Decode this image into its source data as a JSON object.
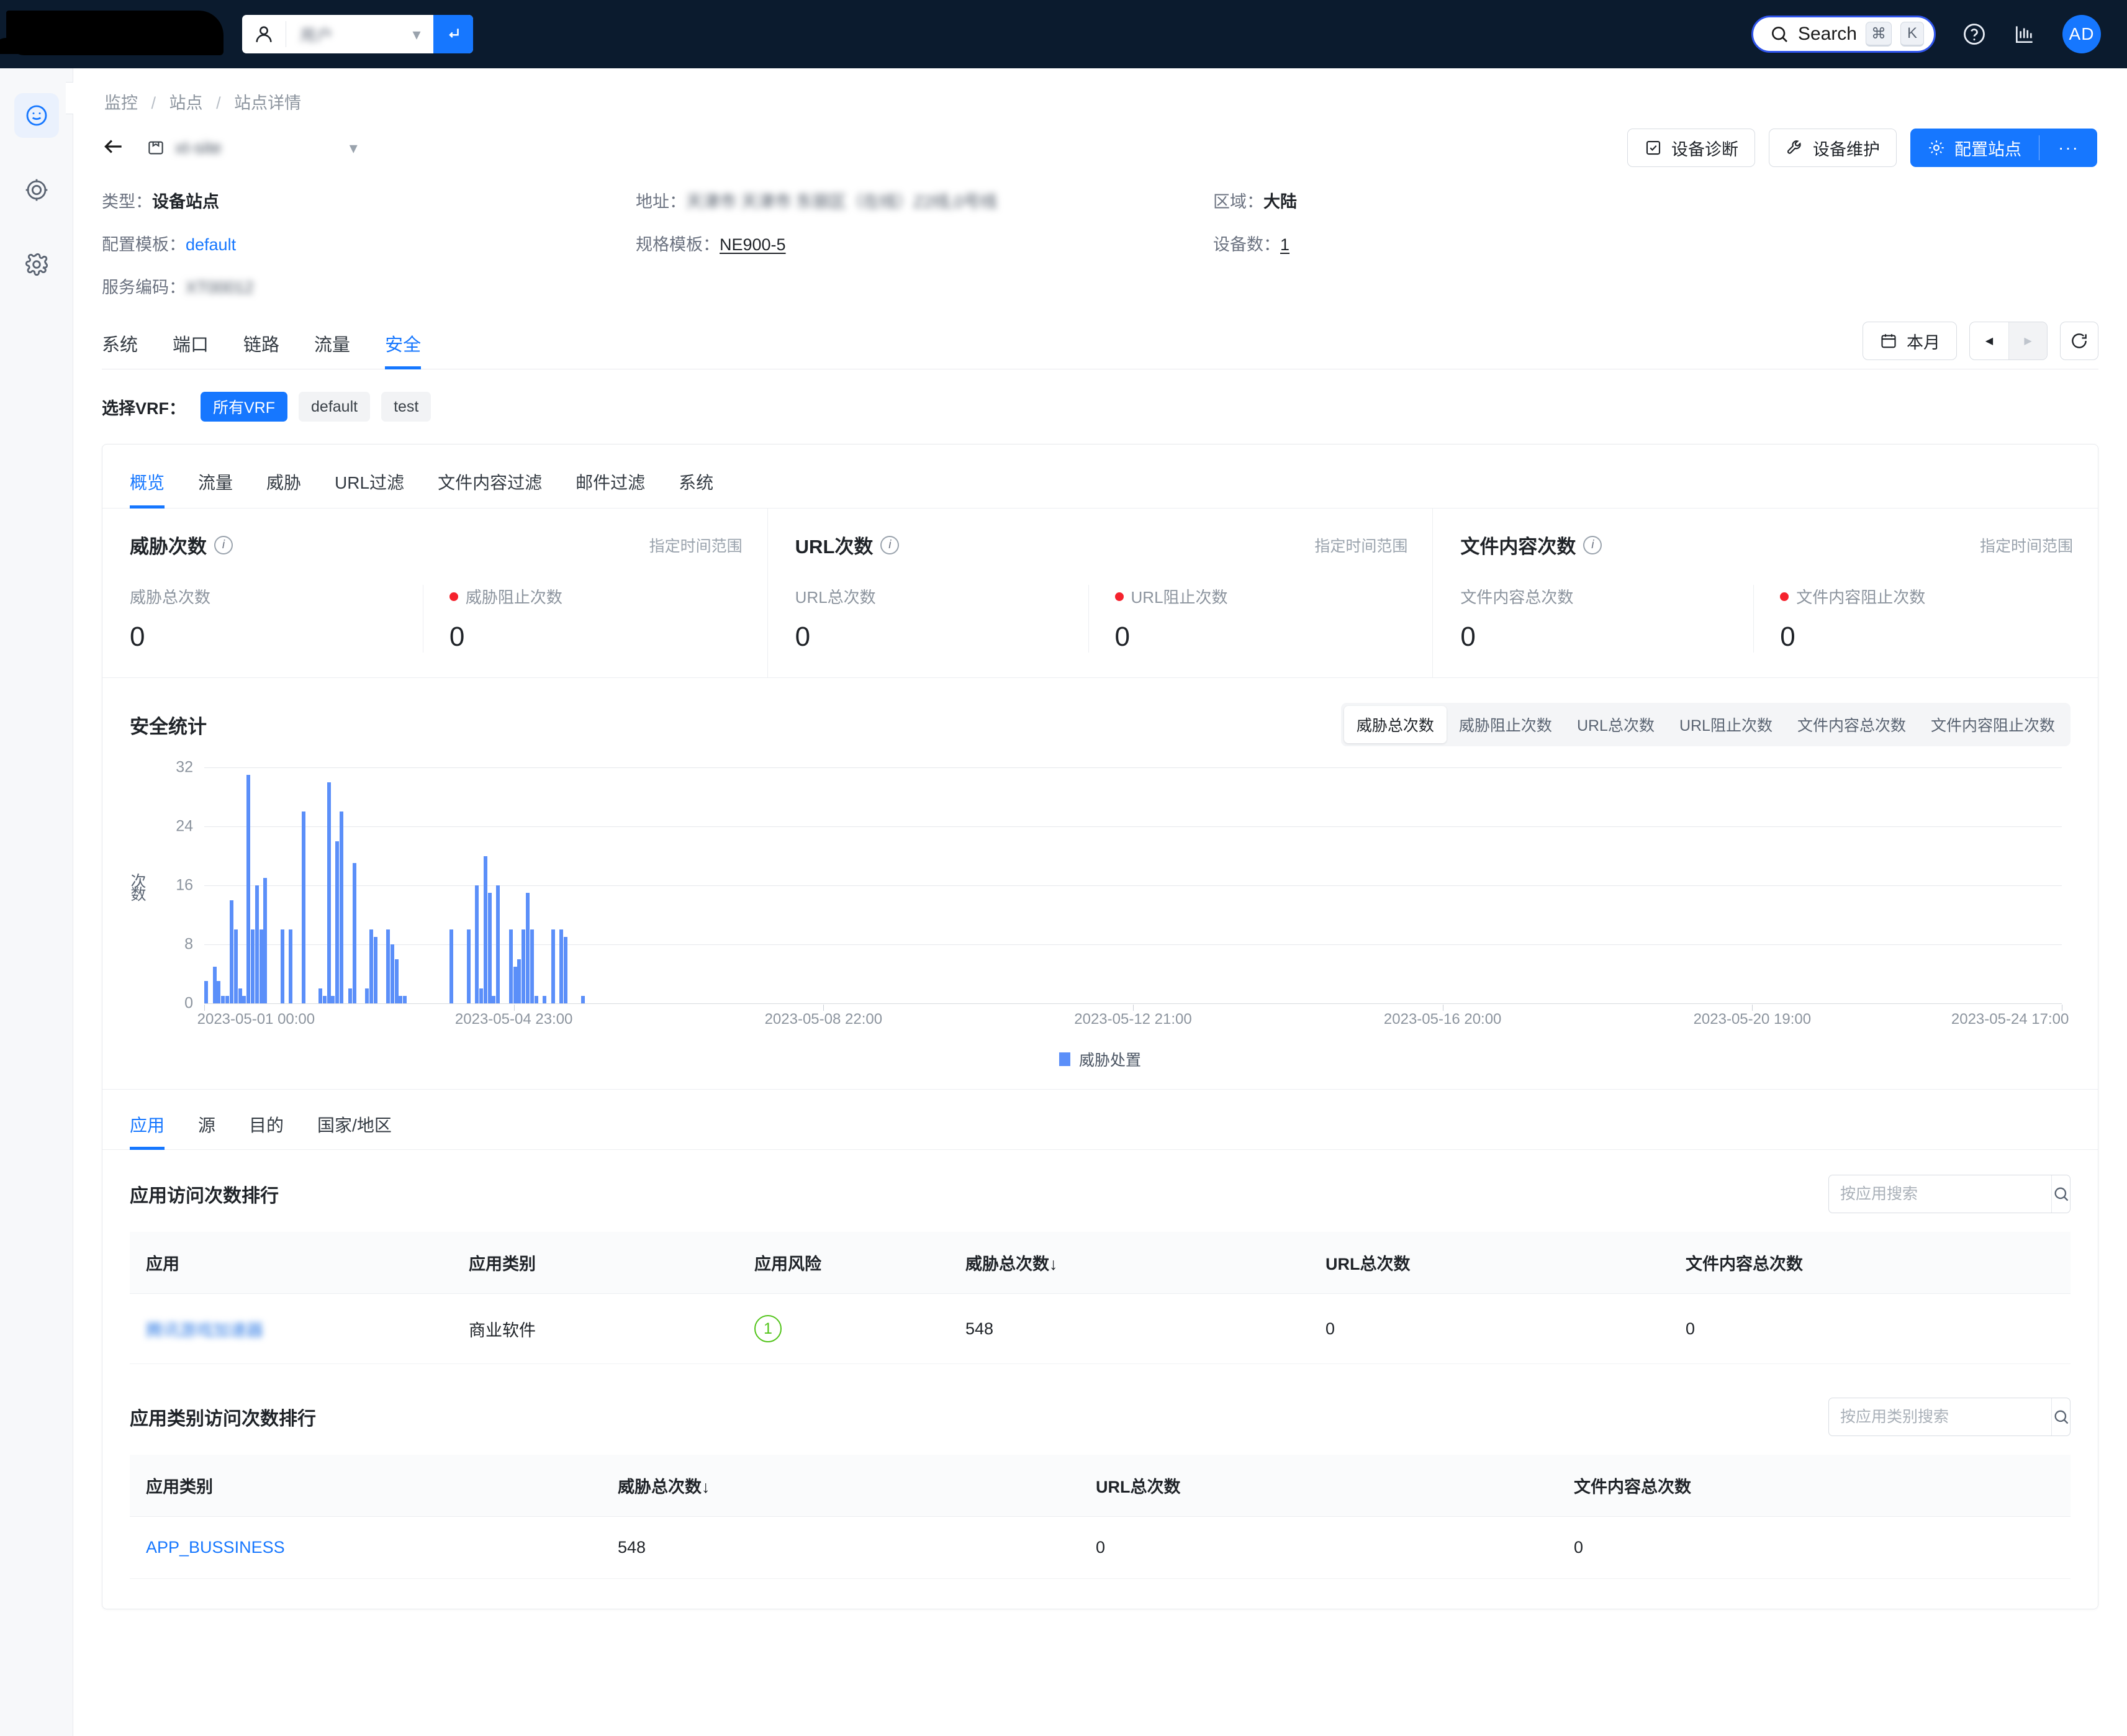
{
  "topnav": {
    "user_value": "用户",
    "go_icon": "enter-arrow-icon",
    "search_label": "Search",
    "kbd_cmd": "⌘",
    "kbd_k": "K",
    "avatar_initials": "AD"
  },
  "breadcrumb": {
    "items": [
      "监控",
      "站点",
      "站点详情"
    ],
    "separator": "/"
  },
  "header": {
    "site_name": "xt-site",
    "buttons": {
      "diagnose": "设备诊断",
      "maintain": "设备维护",
      "configure": "配置站点",
      "more": "···"
    }
  },
  "info": {
    "type_label": "类型：",
    "type_value": "设备站点",
    "address_label": "地址：",
    "address_value": "天津市 天津市 东丽区（在线）Z2线,0号线",
    "region_label": "区域：",
    "region_value": "大陆",
    "config_template_label": "配置模板：",
    "config_template_value": "default",
    "spec_template_label": "规格模板：",
    "spec_template_value": "NE900-5",
    "device_count_label": "设备数：",
    "device_count_value": "1",
    "service_code_label": "服务编码：",
    "service_code_value": "XT00012"
  },
  "main_tabs": {
    "items": [
      "系统",
      "端口",
      "链路",
      "流量",
      "安全"
    ],
    "active": "安全",
    "date_range": "本月",
    "calendar_icon": "calendar-icon",
    "prev_icon": "◀",
    "next_icon": "▶",
    "refresh_icon": "refresh-icon"
  },
  "vrf": {
    "label": "选择VRF：",
    "options": [
      "所有VRF",
      "default",
      "test"
    ],
    "active": "所有VRF"
  },
  "sub_tabs": {
    "items": [
      "概览",
      "流量",
      "威胁",
      "URL过滤",
      "文件内容过滤",
      "邮件过滤",
      "系统"
    ],
    "active": "概览"
  },
  "stats": [
    {
      "title": "威胁次数",
      "range_note": "指定时间范围",
      "total_label": "威胁总次数",
      "total_value": "0",
      "blocked_label": "威胁阻止次数",
      "blocked_value": "0"
    },
    {
      "title": "URL次数",
      "range_note": "指定时间范围",
      "total_label": "URL总次数",
      "total_value": "0",
      "blocked_label": "URL阻止次数",
      "blocked_value": "0"
    },
    {
      "title": "文件内容次数",
      "range_note": "指定时间范围",
      "total_label": "文件内容总次数",
      "total_value": "0",
      "blocked_label": "文件内容阻止次数",
      "blocked_value": "0"
    }
  ],
  "chart_section": {
    "title": "安全统计",
    "segments": [
      "威胁总次数",
      "威胁阻止次数",
      "URL总次数",
      "URL阻止次数",
      "文件内容总次数",
      "文件内容阻止次数"
    ],
    "active_segment": "威胁总次数"
  },
  "chart_data": {
    "type": "bar",
    "title": "安全统计",
    "xlabel": "",
    "ylabel": "次数",
    "ylim": [
      0,
      32
    ],
    "yticks": [
      0,
      8,
      16,
      24,
      32
    ],
    "grid": true,
    "legend_position": "bottom",
    "series": [
      {
        "name": "威胁处置",
        "color": "#5b8ff9",
        "values": [
          3,
          0,
          5,
          3,
          1,
          1,
          14,
          10,
          2,
          1,
          31,
          10,
          16,
          10,
          17,
          0,
          0,
          0,
          10,
          0,
          10,
          0,
          0,
          26,
          0,
          0,
          0,
          2,
          1,
          30,
          1,
          22,
          26,
          0,
          2,
          19,
          0,
          0,
          2,
          10,
          9,
          0,
          0,
          10,
          8,
          6,
          1,
          1,
          0,
          0,
          0,
          0,
          0,
          0,
          0,
          0,
          0,
          0,
          10,
          0,
          0,
          0,
          10,
          0,
          16,
          2,
          20,
          15,
          1,
          16,
          0,
          0,
          10,
          5,
          6,
          10,
          15,
          10,
          1,
          0,
          1,
          0,
          10,
          0,
          10,
          9,
          0,
          0,
          0,
          1
        ]
      }
    ],
    "xticks": [
      "2023-05-01 00:00",
      "2023-05-04 23:00",
      "2023-05-08 22:00",
      "2023-05-12 21:00",
      "2023-05-16 20:00",
      "2023-05-20 19:00",
      "2023-05-24 17:00"
    ],
    "legend": [
      "威胁处置"
    ]
  },
  "bottom_tabs": {
    "items": [
      "应用",
      "源",
      "目的",
      "国家/地区"
    ],
    "active": "应用"
  },
  "app_table": {
    "title": "应用访问次数排行",
    "search_placeholder": "按应用搜索",
    "columns": [
      "应用",
      "应用类别",
      "应用风险",
      "威胁总次数↓",
      "URL总次数",
      "文件内容总次数"
    ],
    "rows": [
      {
        "app": "腾讯游戏加速器",
        "category": "商业软件",
        "risk": "1",
        "threat_total": "548",
        "url_total": "0",
        "file_total": "0"
      }
    ]
  },
  "category_table": {
    "title": "应用类别访问次数排行",
    "search_placeholder": "按应用类别搜索",
    "columns": [
      "应用类别",
      "威胁总次数↓",
      "URL总次数",
      "文件内容总次数"
    ],
    "rows": [
      {
        "category": "APP_BUSSINESS",
        "threat_total": "548",
        "url_total": "0",
        "file_total": "0"
      }
    ]
  },
  "colors": {
    "accent": "#1677ff",
    "bar": "#5b8ff9",
    "danger": "#f5222d",
    "success": "#52c41a",
    "topnav_bg": "#0b1b2e"
  }
}
